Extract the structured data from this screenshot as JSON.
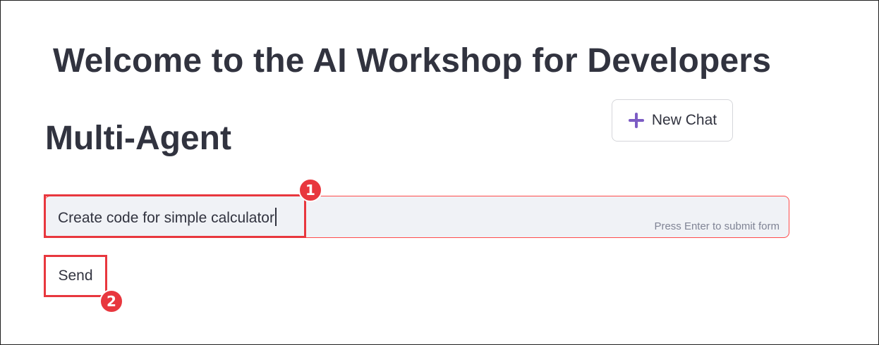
{
  "header": {
    "title": "Welcome to the AI Workshop for Developers"
  },
  "main": {
    "section_title": "Multi-Agent",
    "new_chat_button": {
      "label": "New Chat",
      "icon": "plus-icon",
      "icon_color": "#7c5cc4"
    },
    "chat_input": {
      "value": "Create code for simple calculator",
      "hint": "Press Enter to submit form"
    },
    "send_button": {
      "label": "Send"
    }
  },
  "annotations": {
    "step_1": "1",
    "step_2": "2",
    "highlight_color": "#e8373e"
  }
}
